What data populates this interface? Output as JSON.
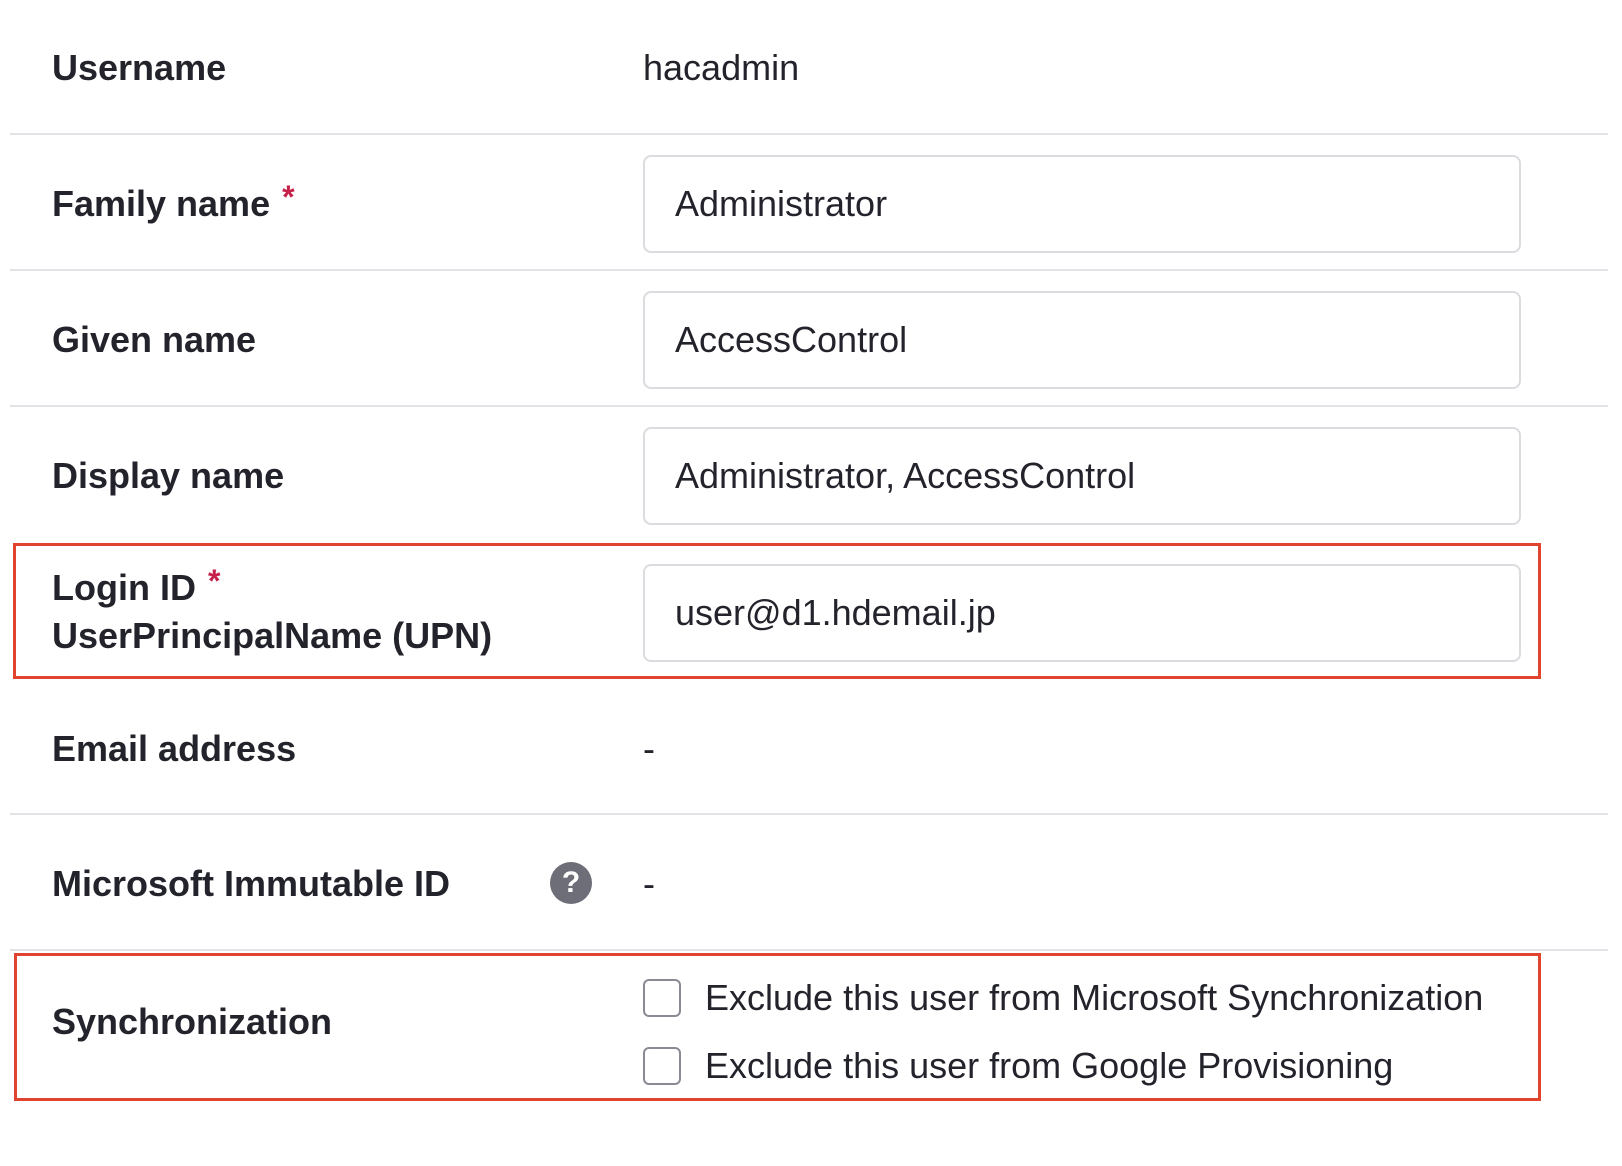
{
  "username": {
    "label": "Username",
    "value": "hacadmin"
  },
  "family_name": {
    "label": "Family name",
    "required_mark": "*",
    "value": "Administrator"
  },
  "given_name": {
    "label": "Given name",
    "value": "AccessControl"
  },
  "display_name": {
    "label": "Display name",
    "value": "Administrator, AccessControl"
  },
  "login_id": {
    "label": "Login ID",
    "required_mark": "*",
    "sublabel": "UserPrincipalName (UPN)",
    "value": "user@d1.hdemail.jp"
  },
  "email_address": {
    "label": "Email address",
    "value": "-"
  },
  "immutable_id": {
    "label": "Microsoft Immutable ID",
    "help_icon": "question-circle-icon",
    "help_glyph": "?",
    "value": "-"
  },
  "synchronization": {
    "label": "Synchronization",
    "options": [
      {
        "label": "Exclude this user from Microsoft Synchronization",
        "checked": false
      },
      {
        "label": "Exclude this user from Google Provisioning",
        "checked": false
      }
    ]
  },
  "colors": {
    "highlight_border": "#e0442e",
    "required_mark": "#c7204a",
    "divider": "#e4e4e8",
    "help_icon_bg": "#6e6e78"
  }
}
